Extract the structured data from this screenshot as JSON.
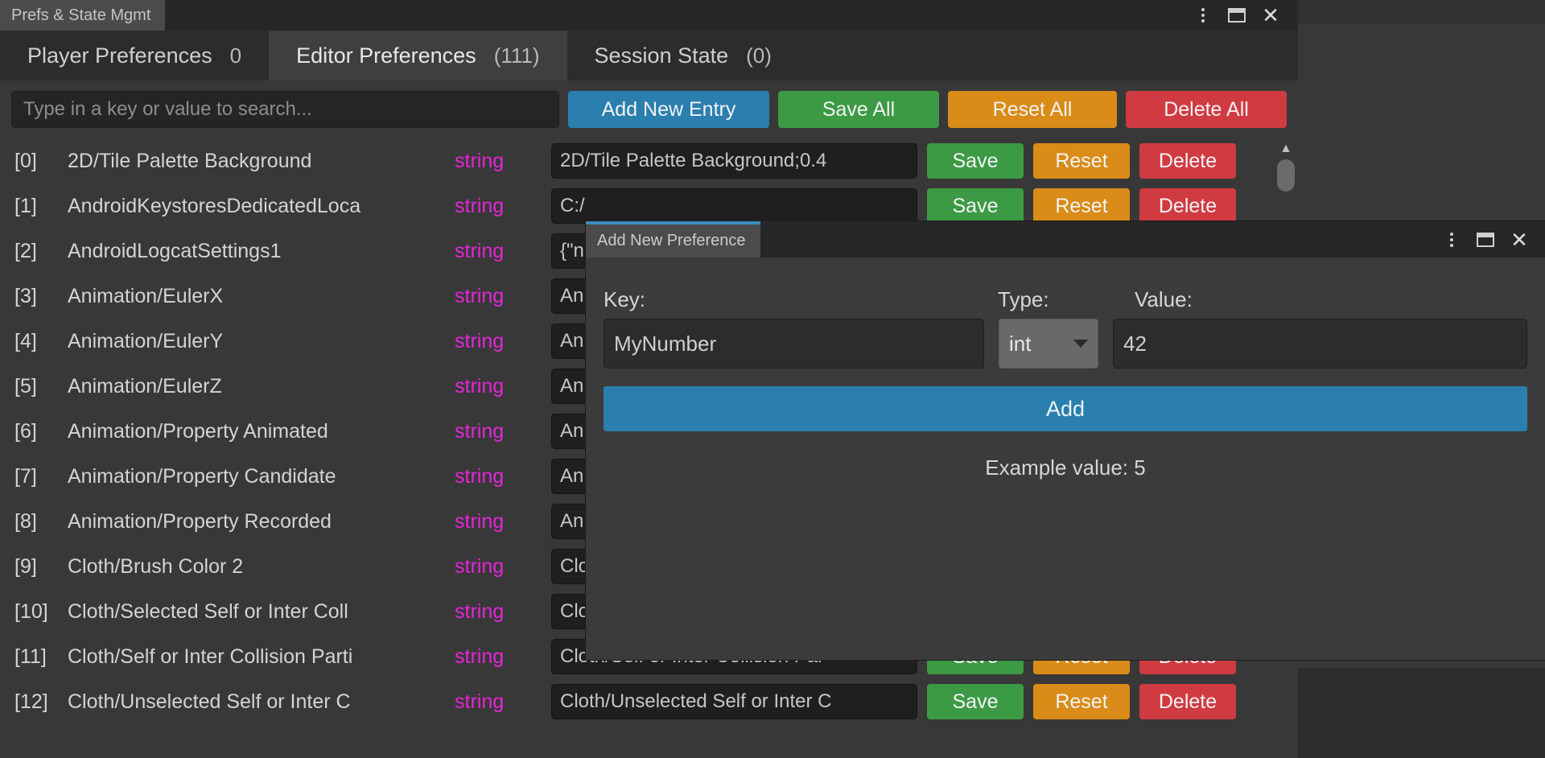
{
  "window": {
    "title": "Prefs & State Mgmt",
    "controls": {
      "menu": "⋮",
      "maximize": "maximize-icon",
      "close": "✕"
    }
  },
  "tabs": [
    {
      "label": "Player Preferences",
      "count": "0",
      "active": false
    },
    {
      "label": "Editor Preferences",
      "count": "(111)",
      "active": true
    },
    {
      "label": "Session State",
      "count": "(0)",
      "active": false
    }
  ],
  "toolbar": {
    "search_placeholder": "Type in a key or value to search...",
    "search_value": "",
    "add_new_entry": "Add New Entry",
    "save_all": "Save All",
    "reset_all": "Reset All",
    "delete_all": "Delete All"
  },
  "row_actions": {
    "save": "Save",
    "reset": "Reset",
    "delete": "Delete"
  },
  "entries": [
    {
      "index": "[0]",
      "key": "2D/Tile Palette Background",
      "type": "string",
      "value": "2D/Tile Palette Background;0.4"
    },
    {
      "index": "[1]",
      "key": "AndroidKeystoresDedicatedLoca",
      "type": "string",
      "value": "C:/"
    },
    {
      "index": "[2]",
      "key": "AndroidLogcatSettings1",
      "type": "string",
      "value": "{\"n"
    },
    {
      "index": "[3]",
      "key": "Animation/EulerX",
      "type": "string",
      "value": "An"
    },
    {
      "index": "[4]",
      "key": "Animation/EulerY",
      "type": "string",
      "value": "An"
    },
    {
      "index": "[5]",
      "key": "Animation/EulerZ",
      "type": "string",
      "value": "An"
    },
    {
      "index": "[6]",
      "key": "Animation/Property Animated",
      "type": "string",
      "value": "An"
    },
    {
      "index": "[7]",
      "key": "Animation/Property Candidate",
      "type": "string",
      "value": "An"
    },
    {
      "index": "[8]",
      "key": "Animation/Property Recorded",
      "type": "string",
      "value": "An"
    },
    {
      "index": "[9]",
      "key": "Cloth/Brush Color 2",
      "type": "string",
      "value": "Clo"
    },
    {
      "index": "[10]",
      "key": "Cloth/Selected Self or Inter Coll",
      "type": "string",
      "value": "Clo"
    },
    {
      "index": "[11]",
      "key": "Cloth/Self or Inter Collision Parti",
      "type": "string",
      "value": "Cloth/Self or Inter Collision Par"
    },
    {
      "index": "[12]",
      "key": "Cloth/Unselected Self or Inter C",
      "type": "string",
      "value": "Cloth/Unselected Self or Inter C"
    }
  ],
  "dialog": {
    "title": "Add New Preference",
    "key_label": "Key:",
    "type_label": "Type:",
    "value_label": "Value:",
    "key_value": "MyNumber",
    "type_value": "int",
    "value_value": "42",
    "add_label": "Add",
    "example_text": "Example value: 5"
  },
  "colors": {
    "accent_blue": "#2b7fae",
    "green": "#3c9a44",
    "orange": "#d98c18",
    "red": "#d03b42",
    "type_magenta": "#e526d7"
  }
}
